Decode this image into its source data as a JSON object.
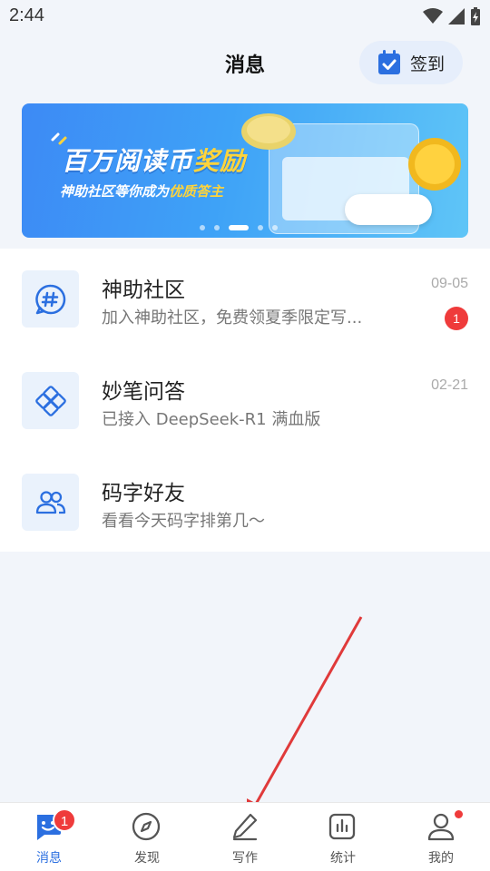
{
  "status": {
    "time": "2:44"
  },
  "header": {
    "title": "消息",
    "signin_label": "签到"
  },
  "banner": {
    "title_main": "百万阅读币",
    "title_highlight": "奖励",
    "subtitle_main": "神助社区等你成为",
    "subtitle_highlight": "优质答主"
  },
  "messages": [
    {
      "title": "神助社区",
      "subtitle": "加入神助社区，免费领夏季限定写...",
      "date": "09-05",
      "badge": "1",
      "icon": "hashtag-chat-icon"
    },
    {
      "title": "妙笔问答",
      "subtitle": "已接入 DeepSeek-R1 满血版",
      "date": "02-21",
      "badge": "",
      "icon": "diamond-knot-icon"
    },
    {
      "title": "码字好友",
      "subtitle": "看看今天码字排第几～",
      "date": "",
      "badge": "",
      "icon": "friends-icon"
    }
  ],
  "tabbar": {
    "tabs": [
      {
        "label": "消息",
        "icon": "message-icon",
        "active": true,
        "badge": "1"
      },
      {
        "label": "发现",
        "icon": "compass-icon",
        "active": false
      },
      {
        "label": "写作",
        "icon": "pen-icon",
        "active": false
      },
      {
        "label": "统计",
        "icon": "stats-icon",
        "active": false
      },
      {
        "label": "我的",
        "icon": "profile-icon",
        "active": false,
        "dot": true
      }
    ]
  },
  "colors": {
    "accent": "#2b6fe0",
    "badge": "#ef3b3b",
    "arrow": "#e03a3a",
    "background": "#f2f5fa"
  }
}
